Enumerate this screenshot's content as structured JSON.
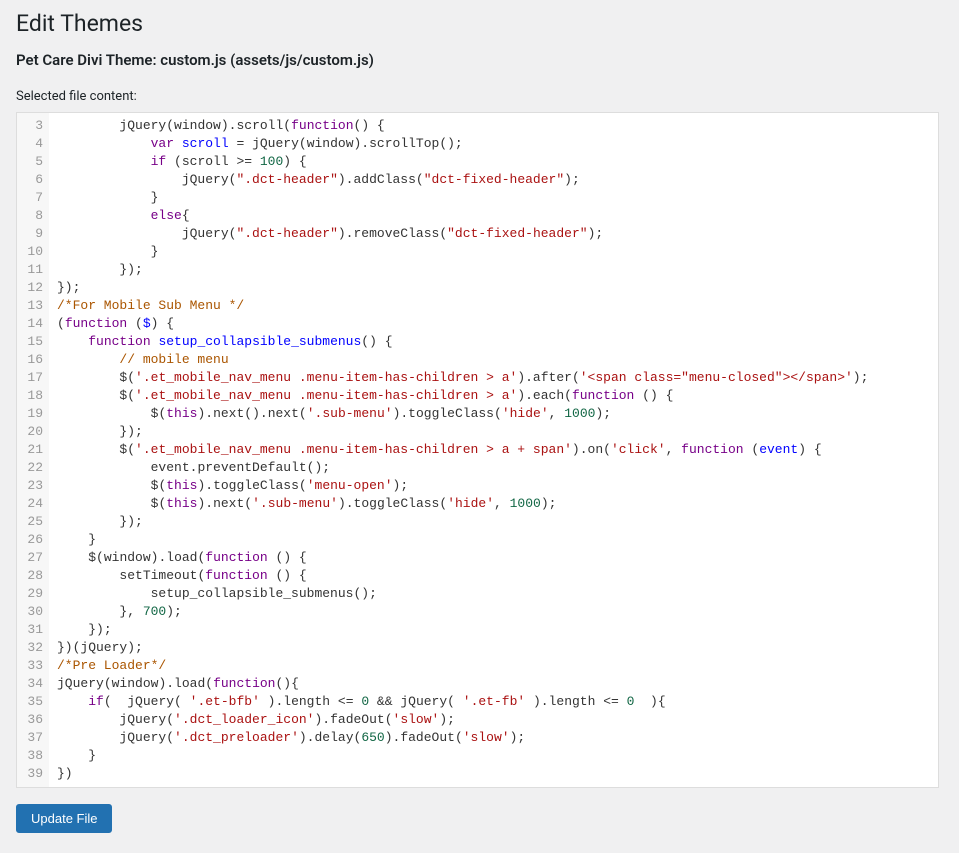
{
  "page_title": "Edit Themes",
  "file_title": "Pet Care Divi Theme: custom.js (assets/js/custom.js)",
  "selected_label": "Selected file content:",
  "update_button": "Update File",
  "line_start": 3,
  "code_lines": [
    {
      "indent": 2,
      "tokens": [
        [
          "var",
          "jQuery"
        ],
        [
          "op",
          "("
        ],
        [
          "var",
          "window"
        ],
        [
          "op",
          ")."
        ],
        [
          "prop",
          "scroll"
        ],
        [
          "op",
          "("
        ],
        [
          "kw",
          "function"
        ],
        [
          "op",
          "() {"
        ]
      ]
    },
    {
      "indent": 3,
      "tokens": [
        [
          "kw",
          "var"
        ],
        [
          "op",
          " "
        ],
        [
          "def",
          "scroll"
        ],
        [
          "op",
          " = "
        ],
        [
          "var",
          "jQuery"
        ],
        [
          "op",
          "("
        ],
        [
          "var",
          "window"
        ],
        [
          "op",
          ")."
        ],
        [
          "prop",
          "scrollTop"
        ],
        [
          "op",
          "();"
        ]
      ]
    },
    {
      "indent": 3,
      "tokens": [
        [
          "kw",
          "if"
        ],
        [
          "op",
          " ("
        ],
        [
          "var",
          "scroll"
        ],
        [
          "op",
          " >= "
        ],
        [
          "num",
          "100"
        ],
        [
          "op",
          ") {"
        ]
      ]
    },
    {
      "indent": 4,
      "tokens": [
        [
          "var",
          "jQuery"
        ],
        [
          "op",
          "("
        ],
        [
          "str",
          "\".dct-header\""
        ],
        [
          "op",
          ")."
        ],
        [
          "prop",
          "addClass"
        ],
        [
          "op",
          "("
        ],
        [
          "str",
          "\"dct-fixed-header\""
        ],
        [
          "op",
          ");"
        ]
      ]
    },
    {
      "indent": 3,
      "tokens": [
        [
          "op",
          "}"
        ]
      ]
    },
    {
      "indent": 3,
      "tokens": [
        [
          "kw",
          "else"
        ],
        [
          "op",
          "{"
        ]
      ]
    },
    {
      "indent": 4,
      "tokens": [
        [
          "var",
          "jQuery"
        ],
        [
          "op",
          "("
        ],
        [
          "str",
          "\".dct-header\""
        ],
        [
          "op",
          ")."
        ],
        [
          "prop",
          "removeClass"
        ],
        [
          "op",
          "("
        ],
        [
          "str",
          "\"dct-fixed-header\""
        ],
        [
          "op",
          ");"
        ]
      ]
    },
    {
      "indent": 3,
      "tokens": [
        [
          "op",
          "}"
        ]
      ]
    },
    {
      "indent": 2,
      "tokens": [
        [
          "op",
          "});"
        ]
      ]
    },
    {
      "indent": 0,
      "tokens": [
        [
          "op",
          "});"
        ]
      ]
    },
    {
      "indent": 0,
      "tokens": [
        [
          "cmt",
          "/*For Mobile Sub Menu */"
        ]
      ]
    },
    {
      "indent": 0,
      "tokens": [
        [
          "op",
          "("
        ],
        [
          "kw",
          "function"
        ],
        [
          "op",
          " ("
        ],
        [
          "def",
          "$"
        ],
        [
          "op",
          ") {"
        ]
      ]
    },
    {
      "indent": 1,
      "tokens": [
        [
          "kw",
          "function"
        ],
        [
          "op",
          " "
        ],
        [
          "def",
          "setup_collapsible_submenus"
        ],
        [
          "op",
          "() {"
        ]
      ]
    },
    {
      "indent": 2,
      "tokens": [
        [
          "cmt",
          "// mobile menu"
        ]
      ]
    },
    {
      "indent": 2,
      "tokens": [
        [
          "var",
          "$"
        ],
        [
          "op",
          "("
        ],
        [
          "str",
          "'.et_mobile_nav_menu .menu-item-has-children > a'"
        ],
        [
          "op",
          ")."
        ],
        [
          "prop",
          "after"
        ],
        [
          "op",
          "("
        ],
        [
          "str",
          "'<span class=\"menu-closed\"></span>'"
        ],
        [
          "op",
          ");"
        ]
      ]
    },
    {
      "indent": 2,
      "tokens": [
        [
          "var",
          "$"
        ],
        [
          "op",
          "("
        ],
        [
          "str",
          "'.et_mobile_nav_menu .menu-item-has-children > a'"
        ],
        [
          "op",
          ")."
        ],
        [
          "prop",
          "each"
        ],
        [
          "op",
          "("
        ],
        [
          "kw",
          "function"
        ],
        [
          "op",
          " () {"
        ]
      ]
    },
    {
      "indent": 3,
      "tokens": [
        [
          "var",
          "$"
        ],
        [
          "op",
          "("
        ],
        [
          "kw",
          "this"
        ],
        [
          "op",
          ")."
        ],
        [
          "prop",
          "next"
        ],
        [
          "op",
          "()."
        ],
        [
          "prop",
          "next"
        ],
        [
          "op",
          "("
        ],
        [
          "str",
          "'.sub-menu'"
        ],
        [
          "op",
          ")."
        ],
        [
          "prop",
          "toggleClass"
        ],
        [
          "op",
          "("
        ],
        [
          "str",
          "'hide'"
        ],
        [
          "op",
          ", "
        ],
        [
          "num",
          "1000"
        ],
        [
          "op",
          ");"
        ]
      ]
    },
    {
      "indent": 2,
      "tokens": [
        [
          "op",
          "});"
        ]
      ]
    },
    {
      "indent": 2,
      "tokens": [
        [
          "var",
          "$"
        ],
        [
          "op",
          "("
        ],
        [
          "str",
          "'.et_mobile_nav_menu .menu-item-has-children > a + span'"
        ],
        [
          "op",
          ")."
        ],
        [
          "prop",
          "on"
        ],
        [
          "op",
          "("
        ],
        [
          "str",
          "'click'"
        ],
        [
          "op",
          ", "
        ],
        [
          "kw",
          "function"
        ],
        [
          "op",
          " ("
        ],
        [
          "def",
          "event"
        ],
        [
          "op",
          ") {"
        ]
      ]
    },
    {
      "indent": 3,
      "tokens": [
        [
          "var",
          "event"
        ],
        [
          "op",
          "."
        ],
        [
          "prop",
          "preventDefault"
        ],
        [
          "op",
          "();"
        ]
      ]
    },
    {
      "indent": 3,
      "tokens": [
        [
          "var",
          "$"
        ],
        [
          "op",
          "("
        ],
        [
          "kw",
          "this"
        ],
        [
          "op",
          ")."
        ],
        [
          "prop",
          "toggleClass"
        ],
        [
          "op",
          "("
        ],
        [
          "str",
          "'menu-open'"
        ],
        [
          "op",
          ");"
        ]
      ]
    },
    {
      "indent": 3,
      "tokens": [
        [
          "var",
          "$"
        ],
        [
          "op",
          "("
        ],
        [
          "kw",
          "this"
        ],
        [
          "op",
          ")."
        ],
        [
          "prop",
          "next"
        ],
        [
          "op",
          "("
        ],
        [
          "str",
          "'.sub-menu'"
        ],
        [
          "op",
          ")."
        ],
        [
          "prop",
          "toggleClass"
        ],
        [
          "op",
          "("
        ],
        [
          "str",
          "'hide'"
        ],
        [
          "op",
          ", "
        ],
        [
          "num",
          "1000"
        ],
        [
          "op",
          ");"
        ]
      ]
    },
    {
      "indent": 2,
      "tokens": [
        [
          "op",
          "});"
        ]
      ]
    },
    {
      "indent": 1,
      "tokens": [
        [
          "op",
          "}"
        ]
      ]
    },
    {
      "indent": 1,
      "tokens": [
        [
          "var",
          "$"
        ],
        [
          "op",
          "("
        ],
        [
          "var",
          "window"
        ],
        [
          "op",
          ")."
        ],
        [
          "prop",
          "load"
        ],
        [
          "op",
          "("
        ],
        [
          "kw",
          "function"
        ],
        [
          "op",
          " () {"
        ]
      ]
    },
    {
      "indent": 2,
      "tokens": [
        [
          "var",
          "setTimeout"
        ],
        [
          "op",
          "("
        ],
        [
          "kw",
          "function"
        ],
        [
          "op",
          " () {"
        ]
      ]
    },
    {
      "indent": 3,
      "tokens": [
        [
          "var",
          "setup_collapsible_submenus"
        ],
        [
          "op",
          "();"
        ]
      ]
    },
    {
      "indent": 2,
      "tokens": [
        [
          "op",
          "}, "
        ],
        [
          "num",
          "700"
        ],
        [
          "op",
          ");"
        ]
      ]
    },
    {
      "indent": 1,
      "tokens": [
        [
          "op",
          "});"
        ]
      ]
    },
    {
      "indent": 0,
      "tokens": [
        [
          "op",
          "})("
        ],
        [
          "var",
          "jQuery"
        ],
        [
          "op",
          ");"
        ]
      ]
    },
    {
      "indent": 0,
      "tokens": [
        [
          "cmt",
          "/*Pre Loader*/"
        ]
      ]
    },
    {
      "indent": 0,
      "tokens": [
        [
          "var",
          "jQuery"
        ],
        [
          "op",
          "("
        ],
        [
          "var",
          "window"
        ],
        [
          "op",
          ")."
        ],
        [
          "prop",
          "load"
        ],
        [
          "op",
          "("
        ],
        [
          "kw",
          "function"
        ],
        [
          "op",
          "(){"
        ]
      ]
    },
    {
      "indent": 1,
      "tokens": [
        [
          "kw",
          "if"
        ],
        [
          "op",
          "(  "
        ],
        [
          "var",
          "jQuery"
        ],
        [
          "op",
          "( "
        ],
        [
          "str",
          "'.et-bfb'"
        ],
        [
          "op",
          " )."
        ],
        [
          "prop",
          "length"
        ],
        [
          "op",
          " <= "
        ],
        [
          "num",
          "0"
        ],
        [
          "op",
          " && "
        ],
        [
          "var",
          "jQuery"
        ],
        [
          "op",
          "( "
        ],
        [
          "str",
          "'.et-fb'"
        ],
        [
          "op",
          " )."
        ],
        [
          "prop",
          "length"
        ],
        [
          "op",
          " <= "
        ],
        [
          "num",
          "0"
        ],
        [
          "op",
          "  ){"
        ]
      ]
    },
    {
      "indent": 2,
      "tokens": [
        [
          "var",
          "jQuery"
        ],
        [
          "op",
          "("
        ],
        [
          "str",
          "'.dct_loader_icon'"
        ],
        [
          "op",
          ")."
        ],
        [
          "prop",
          "fadeOut"
        ],
        [
          "op",
          "("
        ],
        [
          "str",
          "'slow'"
        ],
        [
          "op",
          ");"
        ]
      ]
    },
    {
      "indent": 2,
      "tokens": [
        [
          "var",
          "jQuery"
        ],
        [
          "op",
          "("
        ],
        [
          "str",
          "'.dct_preloader'"
        ],
        [
          "op",
          ")."
        ],
        [
          "prop",
          "delay"
        ],
        [
          "op",
          "("
        ],
        [
          "num",
          "650"
        ],
        [
          "op",
          ")."
        ],
        [
          "prop",
          "fadeOut"
        ],
        [
          "op",
          "("
        ],
        [
          "str",
          "'slow'"
        ],
        [
          "op",
          ");"
        ]
      ]
    },
    {
      "indent": 1,
      "tokens": [
        [
          "op",
          "}"
        ]
      ]
    },
    {
      "indent": 0,
      "tokens": [
        [
          "op",
          "})"
        ]
      ]
    }
  ]
}
